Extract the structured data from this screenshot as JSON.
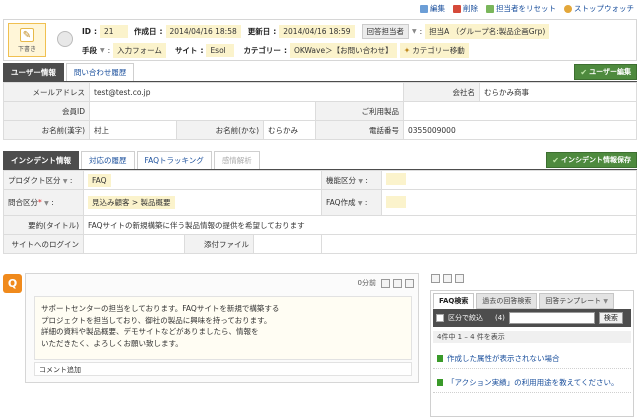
{
  "top_actions": {
    "edit": "編集",
    "delete": "削除",
    "reset_assignee": "担当者をリセット",
    "stopwatch": "ストップウォッチ"
  },
  "header": {
    "draft_label": "下書き",
    "id_label": "ID",
    "id_value": "21",
    "created_label": "作成日",
    "created_value": "2014/04/16 18:58",
    "updated_label": "更新日",
    "updated_value": "2014/04/16 18:59",
    "assignee_label": "回答担当者",
    "assignee_value": "担当A （グループ名:製品企画Grp)",
    "method_label": "手段",
    "method_value": "入力フォーム",
    "site_label": "サイト",
    "site_value": "Esol",
    "category_label": "カテゴリー",
    "category_value": "OKWave＞【お問い合わせ】",
    "category_move": "カテゴリー移動"
  },
  "user_section": {
    "tabs": [
      "ユーザー情報",
      "問い合わせ履歴"
    ],
    "edit_button": "ユーザー編集",
    "email_label": "メールアドレス",
    "email_value": "test@test.co.jp",
    "company_label": "会社名",
    "company_value": "むらかみ商事",
    "member_id_label": "会員ID",
    "member_id_value": "",
    "product_label": "ご利用製品",
    "product_value": "",
    "name_kanji_label": "お名前(漢字)",
    "name_kanji_value": "村上",
    "name_kana_label": "お名前(かな)",
    "name_kana_value": "むらかみ",
    "phone_label": "電話番号",
    "phone_value": "0355009000"
  },
  "incident_section": {
    "tabs": [
      "インシデント情報",
      "対応の履歴",
      "FAQトラッキング",
      "感情解析"
    ],
    "save_button": "インシデント情報保存",
    "product_cat_label": "プロダクト区分",
    "product_cat_value": "FAQ",
    "function_cat_label": "機能区分",
    "function_cat_value": "",
    "inquiry_cat_label": "問合区分",
    "inquiry_cat_value": "見込み顧客 > 製品概要",
    "faq_create_label": "FAQ作成",
    "faq_create_value": "",
    "summary_label": "要約(タイトル)",
    "summary_value": "FAQサイトの新規構築に伴う製品情報の提供を希望しております",
    "site_login_label": "サイトへのログイン",
    "site_login_value": "",
    "attachment_label": "添付ファイル",
    "attachment_value": ""
  },
  "question": {
    "icon": "Q",
    "time_ago": "0分前",
    "lines": [
      "サポートセンターの担当をしております。FAQサイトを新規で構築する",
      "プロジェクトを担当しており、御社の製品に興味を持っております。",
      "詳細の資料や製品概要、デモサイトなどがありましたら、情報を",
      "いただきたく、よろしくお願い致します。"
    ],
    "add_comment": "コメント追加"
  },
  "faq_panel": {
    "tabs": [
      "FAQ検索",
      "過去の回答検索",
      "回答テンプレート"
    ],
    "narrow_label": "区分で絞込",
    "narrow_count": "(4)",
    "search_placeholder": "",
    "search_button": "検索",
    "result_count": "4件中 1 – 4 件を表示",
    "results": [
      "作成した属性が表示されない場合",
      "「アクション実績」の利用用途を教えてください。"
    ]
  }
}
